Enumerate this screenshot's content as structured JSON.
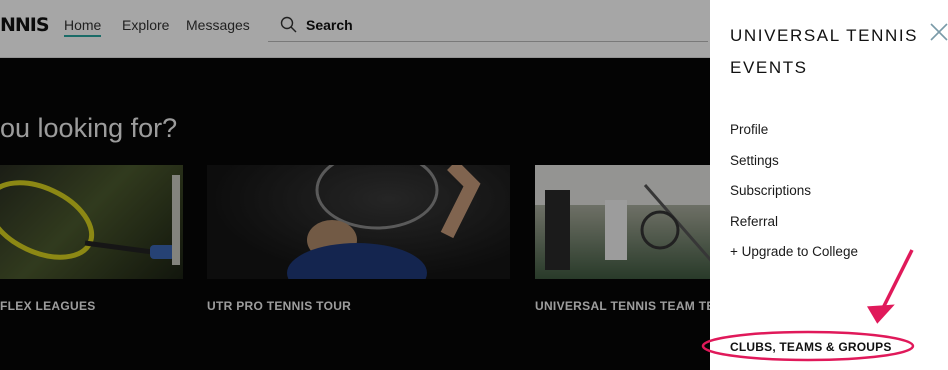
{
  "header": {
    "logo": "NNIS",
    "nav": [
      "Home",
      "Explore",
      "Messages"
    ],
    "search_label": "Search"
  },
  "hero": {
    "title": "ou looking for?",
    "cards": [
      {
        "label": "FLEX LEAGUES"
      },
      {
        "label": "UTR PRO TENNIS TOUR"
      },
      {
        "label": "UNIVERSAL TENNIS TEAM TE"
      }
    ]
  },
  "drawer": {
    "title": "UNIVERSAL TENNIS EVENTS",
    "menu": [
      "Profile",
      "Settings",
      "Subscriptions",
      "Referral",
      "+ Upgrade to College"
    ],
    "clubs_label": "CLUBS, TEAMS & GROUPS"
  },
  "colors": {
    "nav_underline": "#2aa6a0",
    "annotation": "#e0195a",
    "close_icon": "#7a9aa8"
  }
}
